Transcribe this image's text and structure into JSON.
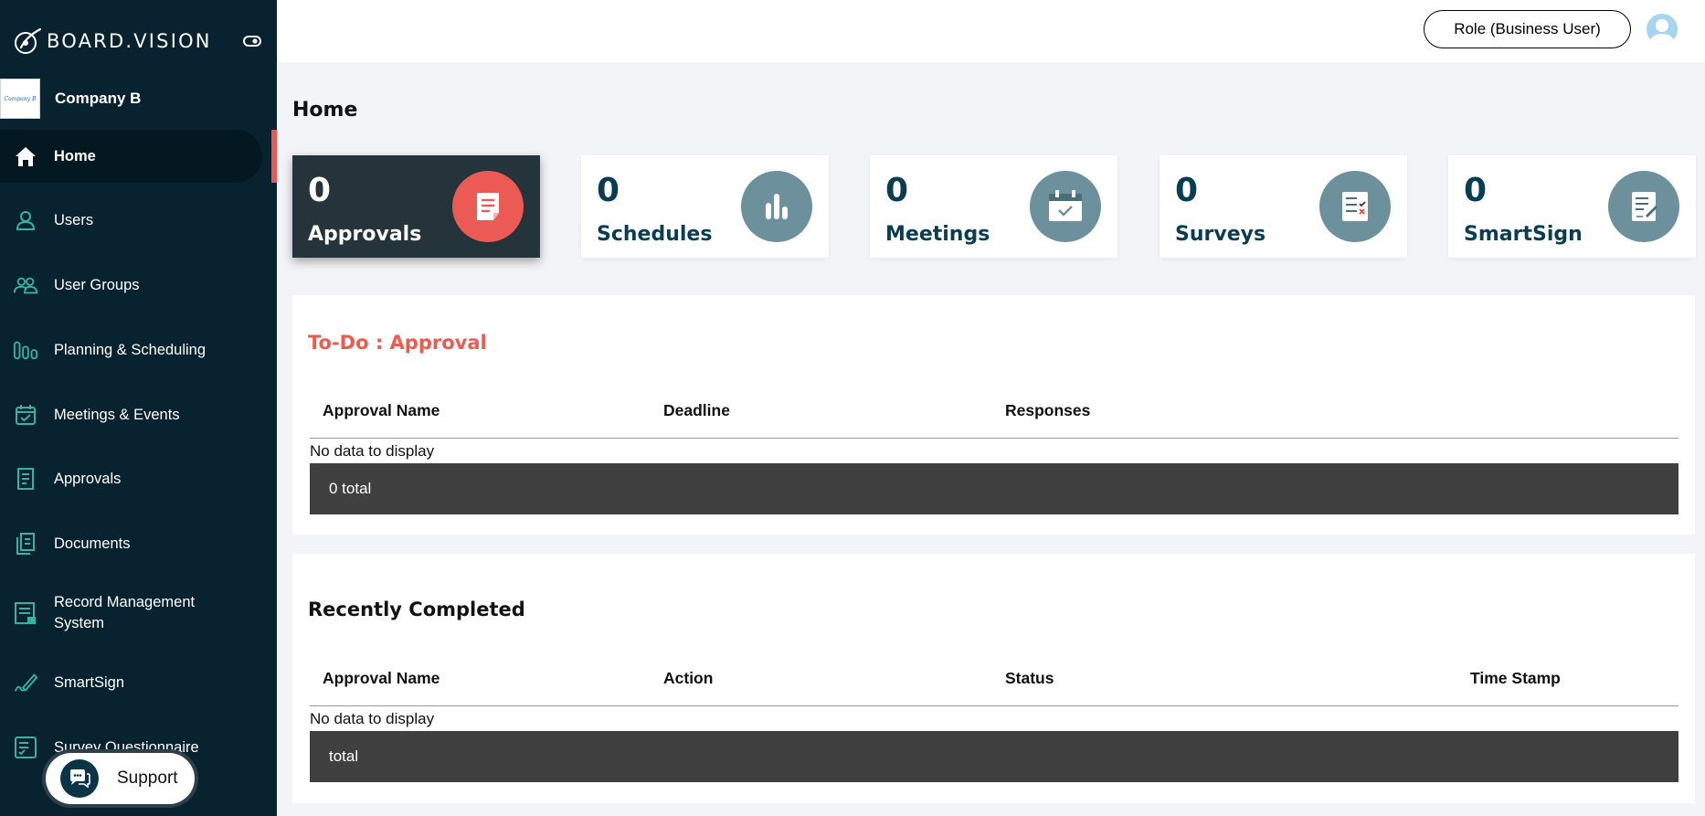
{
  "brand": {
    "name": "BOARD.VISION"
  },
  "company": {
    "name": "Company B",
    "logo_text": "Company B"
  },
  "sidebar": {
    "items": [
      {
        "label": "Home",
        "icon": "home-icon"
      },
      {
        "label": "Users",
        "icon": "user-icon"
      },
      {
        "label": "User Groups",
        "icon": "user-group-icon"
      },
      {
        "label": "Planning & Scheduling",
        "icon": "planning-icon"
      },
      {
        "label": "Meetings & Events",
        "icon": "calendar-check-icon"
      },
      {
        "label": "Approvals",
        "icon": "approval-doc-icon"
      },
      {
        "label": "Documents",
        "icon": "documents-icon"
      },
      {
        "label": "Record Management System",
        "icon": "record-icon"
      },
      {
        "label": "SmartSign",
        "icon": "pen-icon"
      },
      {
        "label": "Survey Questionnaire",
        "icon": "survey-icon"
      }
    ]
  },
  "support": {
    "label": "Support"
  },
  "header": {
    "role_label": "Role (Business User)"
  },
  "page": {
    "title": "Home"
  },
  "cards": [
    {
      "count": "0",
      "label": "Approvals"
    },
    {
      "count": "0",
      "label": "Schedules"
    },
    {
      "count": "0",
      "label": "Meetings"
    },
    {
      "count": "0",
      "label": "Surveys"
    },
    {
      "count": "0",
      "label": "SmartSign"
    }
  ],
  "todo": {
    "title": "To-Do : Approval",
    "columns": [
      "Approval Name",
      "Deadline",
      "Responses"
    ],
    "empty_text": "No data to display",
    "total_text": "0 total"
  },
  "recent": {
    "title": "Recently Completed",
    "columns": [
      "Approval Name",
      "Action",
      "Status",
      "Time Stamp"
    ],
    "empty_text": "No data to display",
    "total_text": "total"
  },
  "colors": {
    "sidebar_bg": "#08222f",
    "accent_red": "#e85a50",
    "card_text": "#0b3d52",
    "icon_teal": "#36b3a2",
    "circle_grey": "#6c919c"
  }
}
